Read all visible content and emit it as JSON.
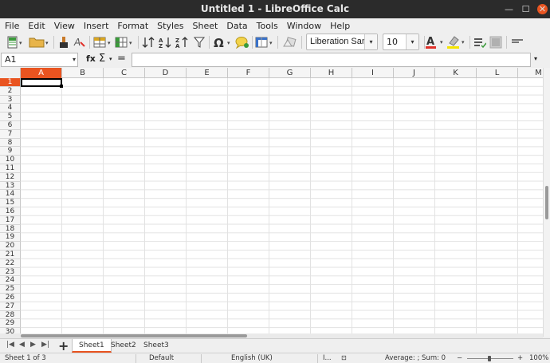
{
  "window": {
    "title": "Untitled 1 - LibreOffice Calc"
  },
  "menu": [
    "File",
    "Edit",
    "View",
    "Insert",
    "Format",
    "Styles",
    "Sheet",
    "Data",
    "Tools",
    "Window",
    "Help"
  ],
  "toolbar": {
    "font_name": "Liberation Sans",
    "font_size": "10",
    "font_color": "#e0312a",
    "highlight_color": "#f5e400",
    "accent": "#e95420"
  },
  "formula_bar": {
    "cell_ref": "A1",
    "fx": "fx",
    "sigma": "Σ",
    "equals": "=",
    "content": ""
  },
  "columns": [
    "A",
    "B",
    "C",
    "D",
    "E",
    "F",
    "G",
    "H",
    "I",
    "J",
    "K",
    "L",
    "M"
  ],
  "rows": [
    "1",
    "2",
    "3",
    "4",
    "5",
    "6",
    "7",
    "8",
    "9",
    "10",
    "11",
    "12",
    "13",
    "14",
    "15",
    "16",
    "17",
    "18",
    "19",
    "20",
    "21",
    "22",
    "23",
    "24",
    "25",
    "26",
    "27",
    "28",
    "29",
    "30"
  ],
  "selected_cell": {
    "column": "A",
    "row": "1"
  },
  "sheets": [
    {
      "name": "Sheet1",
      "active": true
    },
    {
      "name": "Sheet2",
      "active": false
    },
    {
      "name": "Sheet3",
      "active": false
    }
  ],
  "status": {
    "sheet": "Sheet 1 of 3",
    "style": "Default",
    "language": "English (UK)",
    "selection_mode": "I...",
    "summary": "Average: ; Sum: 0",
    "zoom_minus": "−",
    "zoom_plus": "+",
    "zoom": "100%"
  }
}
